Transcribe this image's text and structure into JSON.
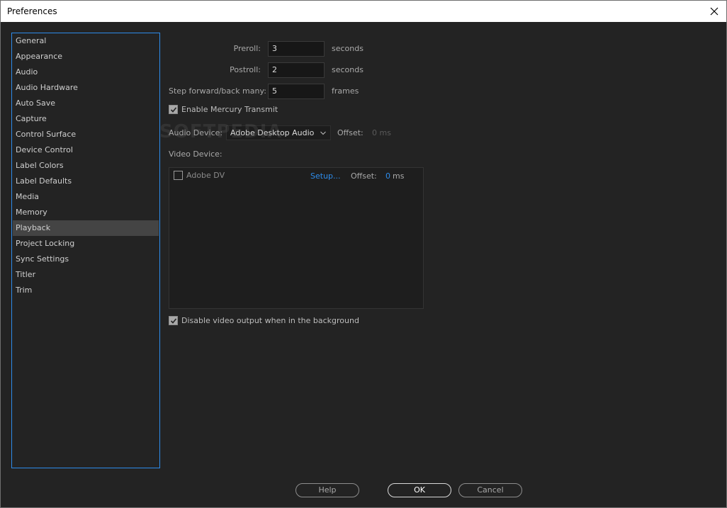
{
  "window": {
    "title": "Preferences"
  },
  "sidebar": {
    "items": [
      {
        "label": "General"
      },
      {
        "label": "Appearance"
      },
      {
        "label": "Audio"
      },
      {
        "label": "Audio Hardware"
      },
      {
        "label": "Auto Save"
      },
      {
        "label": "Capture"
      },
      {
        "label": "Control Surface"
      },
      {
        "label": "Device Control"
      },
      {
        "label": "Label Colors"
      },
      {
        "label": "Label Defaults"
      },
      {
        "label": "Media"
      },
      {
        "label": "Memory"
      },
      {
        "label": "Playback"
      },
      {
        "label": "Project Locking"
      },
      {
        "label": "Sync Settings"
      },
      {
        "label": "Titler"
      },
      {
        "label": "Trim"
      }
    ],
    "selected": "Playback"
  },
  "playback": {
    "preroll": {
      "label": "Preroll:",
      "value": "3",
      "unit": "seconds"
    },
    "postroll": {
      "label": "Postroll:",
      "value": "2",
      "unit": "seconds"
    },
    "step": {
      "label": "Step forward/back many:",
      "value": "5",
      "unit": "frames"
    },
    "mercury": {
      "label": "Enable Mercury Transmit",
      "checked": true
    },
    "audio_device": {
      "label": "Audio Device:",
      "value": "Adobe Desktop Audio",
      "offset_label": "Offset:",
      "offset_value": "0 ms"
    },
    "video_device": {
      "label": "Video Device:",
      "devices": [
        {
          "name": "Adobe DV",
          "checked": false,
          "setup": "Setup...",
          "offset_label": "Offset:",
          "offset_value": "0",
          "offset_unit": "ms"
        }
      ]
    },
    "disable_bg": {
      "label": "Disable video output when in the background",
      "checked": true
    }
  },
  "watermark": "SOFTPEDIA",
  "buttons": {
    "help": "Help",
    "ok": "OK",
    "cancel": "Cancel"
  },
  "colors": {
    "accent": "#2d8ceb",
    "background": "#232323",
    "selected": "#444444"
  },
  "icons": {
    "close": "close-icon",
    "check": "checkmark-icon",
    "dropdown": "chevron-down-icon"
  }
}
